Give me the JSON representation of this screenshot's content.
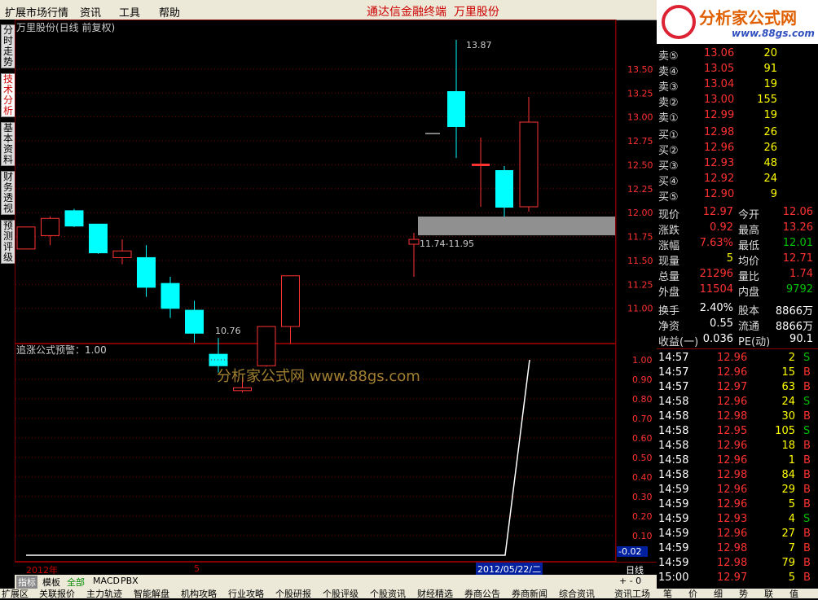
{
  "menu": {
    "items": [
      "扩展市场行情",
      "资讯",
      "工具",
      "帮助"
    ],
    "center_title": "通达信金融终端",
    "center_stock": "万里股份"
  },
  "logo": {
    "name": "分析家公式网",
    "url": "www.88gs.com"
  },
  "sidetabs": [
    "分时走势",
    "技术分析",
    "基本资料",
    "财务透视",
    "预测评级"
  ],
  "chart": {
    "header": "万里股份(日线 前复权)",
    "high_label": "13.87",
    "low_label": "10.76",
    "range_label": "11.74-11.95",
    "price_axis": [
      "13.50",
      "13.25",
      "13.00",
      "12.75",
      "12.50",
      "12.25",
      "12.00",
      "11.75",
      "11.50",
      "11.25",
      "11.00"
    ],
    "indicator_header": "追涨公式预警：1.00",
    "watermark": "分析家公式网 www.88gs.com",
    "indicator_axis": [
      "1.00",
      "0.90",
      "0.80",
      "0.70",
      "0.60",
      "0.50",
      "0.40",
      "0.30",
      "0.20",
      "0.10"
    ],
    "indicator_current": "-0.02"
  },
  "chart_data": {
    "type": "candlestick",
    "ylim": [
      10.7,
      13.95
    ],
    "candles": [
      {
        "o": 11.62,
        "h": 11.85,
        "l": 11.62,
        "c": 11.85,
        "up": true
      },
      {
        "o": 11.76,
        "h": 11.96,
        "l": 11.66,
        "c": 11.94,
        "up": true
      },
      {
        "o": 12.02,
        "h": 12.04,
        "l": 11.85,
        "c": 11.86,
        "up": false
      },
      {
        "o": 11.88,
        "h": 11.88,
        "l": 11.57,
        "c": 11.58,
        "up": false
      },
      {
        "o": 11.6,
        "h": 11.72,
        "l": 11.46,
        "c": 11.53,
        "up": true
      },
      {
        "o": 11.53,
        "h": 11.66,
        "l": 11.12,
        "c": 11.22,
        "up": false
      },
      {
        "o": 11.26,
        "h": 11.33,
        "l": 10.9,
        "c": 11.0,
        "up": false
      },
      {
        "o": 10.98,
        "h": 11.08,
        "l": 10.64,
        "c": 10.74,
        "up": false
      },
      {
        "o": 10.52,
        "h": 10.69,
        "l": 10.33,
        "c": 10.4,
        "up": false
      },
      {
        "o": 10.14,
        "h": 10.28,
        "l": 10.12,
        "c": 10.17,
        "up": true
      },
      {
        "o": 10.4,
        "h": 10.81,
        "l": 10.39,
        "c": 10.81,
        "up": true
      },
      {
        "o": 10.81,
        "h": 11.34,
        "l": 10.63,
        "c": 11.34,
        "up": true
      }
    ],
    "indicator": {
      "x_points": [
        0,
        1
      ],
      "values": [
        0,
        1
      ]
    }
  },
  "dateaxis": {
    "year": "2012年",
    "month": "5",
    "date": "2012/05/22/二"
  },
  "period": "日线",
  "bottom_tabs": [
    "指标",
    "模板",
    "全部",
    "MACD",
    "PBX"
  ],
  "footer": [
    "扩展区",
    "关联报价",
    "主力轨迹",
    "智能解盘",
    "机构攻略",
    "行业攻略",
    "个股研报",
    "个股评级",
    "个股资讯",
    "财经精选",
    "券商公告",
    "券商新闻",
    "综合资讯",
    "资讯工场"
  ],
  "orderbook": {
    "sell": [
      {
        "label": "卖⑤",
        "price": "13.06",
        "vol": "20"
      },
      {
        "label": "卖④",
        "price": "13.05",
        "vol": "91"
      },
      {
        "label": "卖③",
        "price": "13.04",
        "vol": "19"
      },
      {
        "label": "卖②",
        "price": "13.00",
        "vol": "155"
      },
      {
        "label": "卖①",
        "price": "12.99",
        "vol": "19"
      }
    ],
    "buy": [
      {
        "label": "买①",
        "price": "12.98",
        "vol": "26"
      },
      {
        "label": "买②",
        "price": "12.96",
        "vol": "26"
      },
      {
        "label": "买③",
        "price": "12.93",
        "vol": "48"
      },
      {
        "label": "买④",
        "price": "12.92",
        "vol": "24"
      },
      {
        "label": "买⑤",
        "price": "12.90",
        "vol": "9"
      }
    ]
  },
  "quote": [
    {
      "l1": "现价",
      "v1": "12.97",
      "l2": "今开",
      "v2": "12.06"
    },
    {
      "l1": "涨跌",
      "v1": "0.92",
      "l2": "最高",
      "v2": "13.26"
    },
    {
      "l1": "涨幅",
      "v1": "7.63%",
      "l2": "最低",
      "v2": "12.01"
    },
    {
      "l1": "现量",
      "v1": "5",
      "l2": "均价",
      "v2": "12.71"
    },
    {
      "l1": "总量",
      "v1": "21296",
      "l2": "量比",
      "v2": "1.74"
    },
    {
      "l1": "外盘",
      "v1": "11504",
      "l2": "内盘",
      "v2": "9792"
    },
    {
      "l1": "换手",
      "v1": "2.40%",
      "l2": "股本",
      "v2": "8866万"
    },
    {
      "l1": "净资",
      "v1": "0.55",
      "l2": "流通",
      "v2": "8866万"
    },
    {
      "l1": "收益(一)",
      "v1": "0.036",
      "l2": "PE(动)",
      "v2": "90.1"
    }
  ],
  "ticks": [
    {
      "t": "14:57",
      "p": "12.96",
      "v": "2",
      "s": "S"
    },
    {
      "t": "14:57",
      "p": "12.96",
      "v": "15",
      "s": "B"
    },
    {
      "t": "14:57",
      "p": "12.97",
      "v": "63",
      "s": "B"
    },
    {
      "t": "14:58",
      "p": "12.96",
      "v": "24",
      "s": "S"
    },
    {
      "t": "14:58",
      "p": "12.98",
      "v": "30",
      "s": "B"
    },
    {
      "t": "14:58",
      "p": "12.95",
      "v": "105",
      "s": "S"
    },
    {
      "t": "14:58",
      "p": "12.96",
      "v": "18",
      "s": "B"
    },
    {
      "t": "14:58",
      "p": "12.96",
      "v": "1",
      "s": "B"
    },
    {
      "t": "14:58",
      "p": "12.98",
      "v": "84",
      "s": "B"
    },
    {
      "t": "14:59",
      "p": "12.96",
      "v": "29",
      "s": "B"
    },
    {
      "t": "14:59",
      "p": "12.96",
      "v": "5",
      "s": "B"
    },
    {
      "t": "14:59",
      "p": "12.93",
      "v": "4",
      "s": "S"
    },
    {
      "t": "14:59",
      "p": "12.96",
      "v": "27",
      "s": "B"
    },
    {
      "t": "14:59",
      "p": "12.98",
      "v": "7",
      "s": "B"
    },
    {
      "t": "14:59",
      "p": "12.98",
      "v": "79",
      "s": "B"
    },
    {
      "t": "15:00",
      "p": "12.97",
      "v": "5",
      "s": "B"
    }
  ],
  "right_tabs": [
    "笔",
    "价",
    "细",
    "势",
    "联",
    "值"
  ],
  "colors": {
    "up": "#ff3232",
    "down": "#00ffff",
    "grid": "#800000",
    "neutral": "#ffffff",
    "buy": "#ff3232",
    "sell": "#00c000"
  }
}
